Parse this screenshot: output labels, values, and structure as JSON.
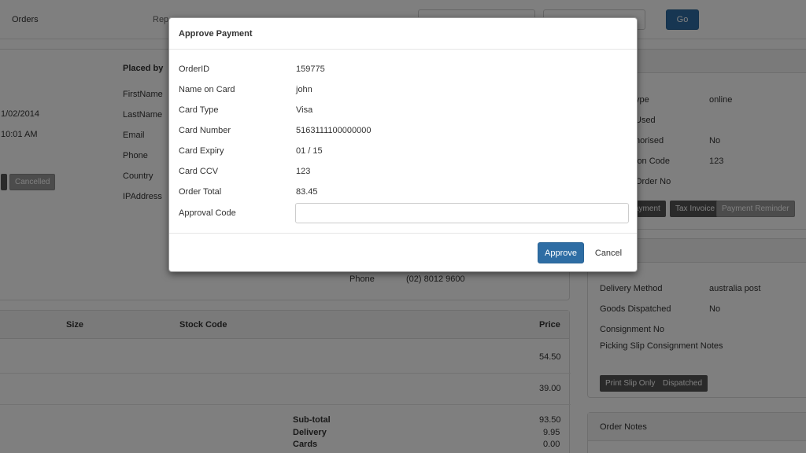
{
  "topbar": {
    "orders_label": "Orders",
    "reports_label": "Rep",
    "go_label": "Go"
  },
  "order_panel": {
    "date": "1/02/2014",
    "time": "10:01 AM",
    "cancelled_label": "Cancelled",
    "placed_by_heading": "Placed by",
    "placed_by_fields": [
      "FirstName",
      "LastName",
      "Email",
      "Phone",
      "Country",
      "IPAddress"
    ],
    "phone_label": "Phone",
    "phone_value": "(02) 8012 9600"
  },
  "payment_panel": {
    "rows": [
      {
        "label": "ype",
        "value": "online"
      },
      {
        "label": "Used",
        "value": ""
      },
      {
        "label": "horised",
        "value": "No"
      },
      {
        "label": "ion Code",
        "value": "123"
      },
      {
        "label": "Order No",
        "value": ""
      }
    ],
    "buttons": [
      "ayment",
      "Tax Invoice",
      "Payment Reminder"
    ]
  },
  "delivery_panel": {
    "rows": [
      {
        "label": "Delivery Method",
        "value": "australia post"
      },
      {
        "label": "Goods Dispatched",
        "value": "No"
      },
      {
        "label": "Consignment No",
        "value": ""
      },
      {
        "label": "Picking Slip Consignment Notes",
        "value": ""
      }
    ],
    "print_slip_label": "Print Slip Only",
    "dispatched_label": "Dispatched"
  },
  "notes_panel": {
    "title": "Order Notes"
  },
  "items_table": {
    "headers": {
      "size": "Size",
      "stock_code": "Stock Code",
      "price": "Price"
    },
    "prices": [
      "54.50",
      "39.00"
    ]
  },
  "totals": [
    {
      "label": "Sub-total",
      "value": "93.50"
    },
    {
      "label": "Delivery",
      "value": "9.95"
    },
    {
      "label": "Cards",
      "value": "0.00"
    }
  ],
  "modal": {
    "title": "Approve Payment",
    "fields": [
      {
        "label": "OrderID",
        "value": "159775"
      },
      {
        "label": "Name on Card",
        "value": "john"
      },
      {
        "label": "Card Type",
        "value": "Visa"
      },
      {
        "label": "Card Number",
        "value": "5163111100000000"
      },
      {
        "label": "Card Expiry",
        "value": "01 / 15"
      },
      {
        "label": "Card CCV",
        "value": "123"
      },
      {
        "label": "Order Total",
        "value": "83.45"
      }
    ],
    "approval_code_label": "Approval Code",
    "approval_code_value": "",
    "approve_label": "Approve",
    "cancel_label": "Cancel"
  },
  "colors": {
    "primary": "#2e6da4",
    "backdrop": "rgba(0,0,0,0.5)"
  }
}
